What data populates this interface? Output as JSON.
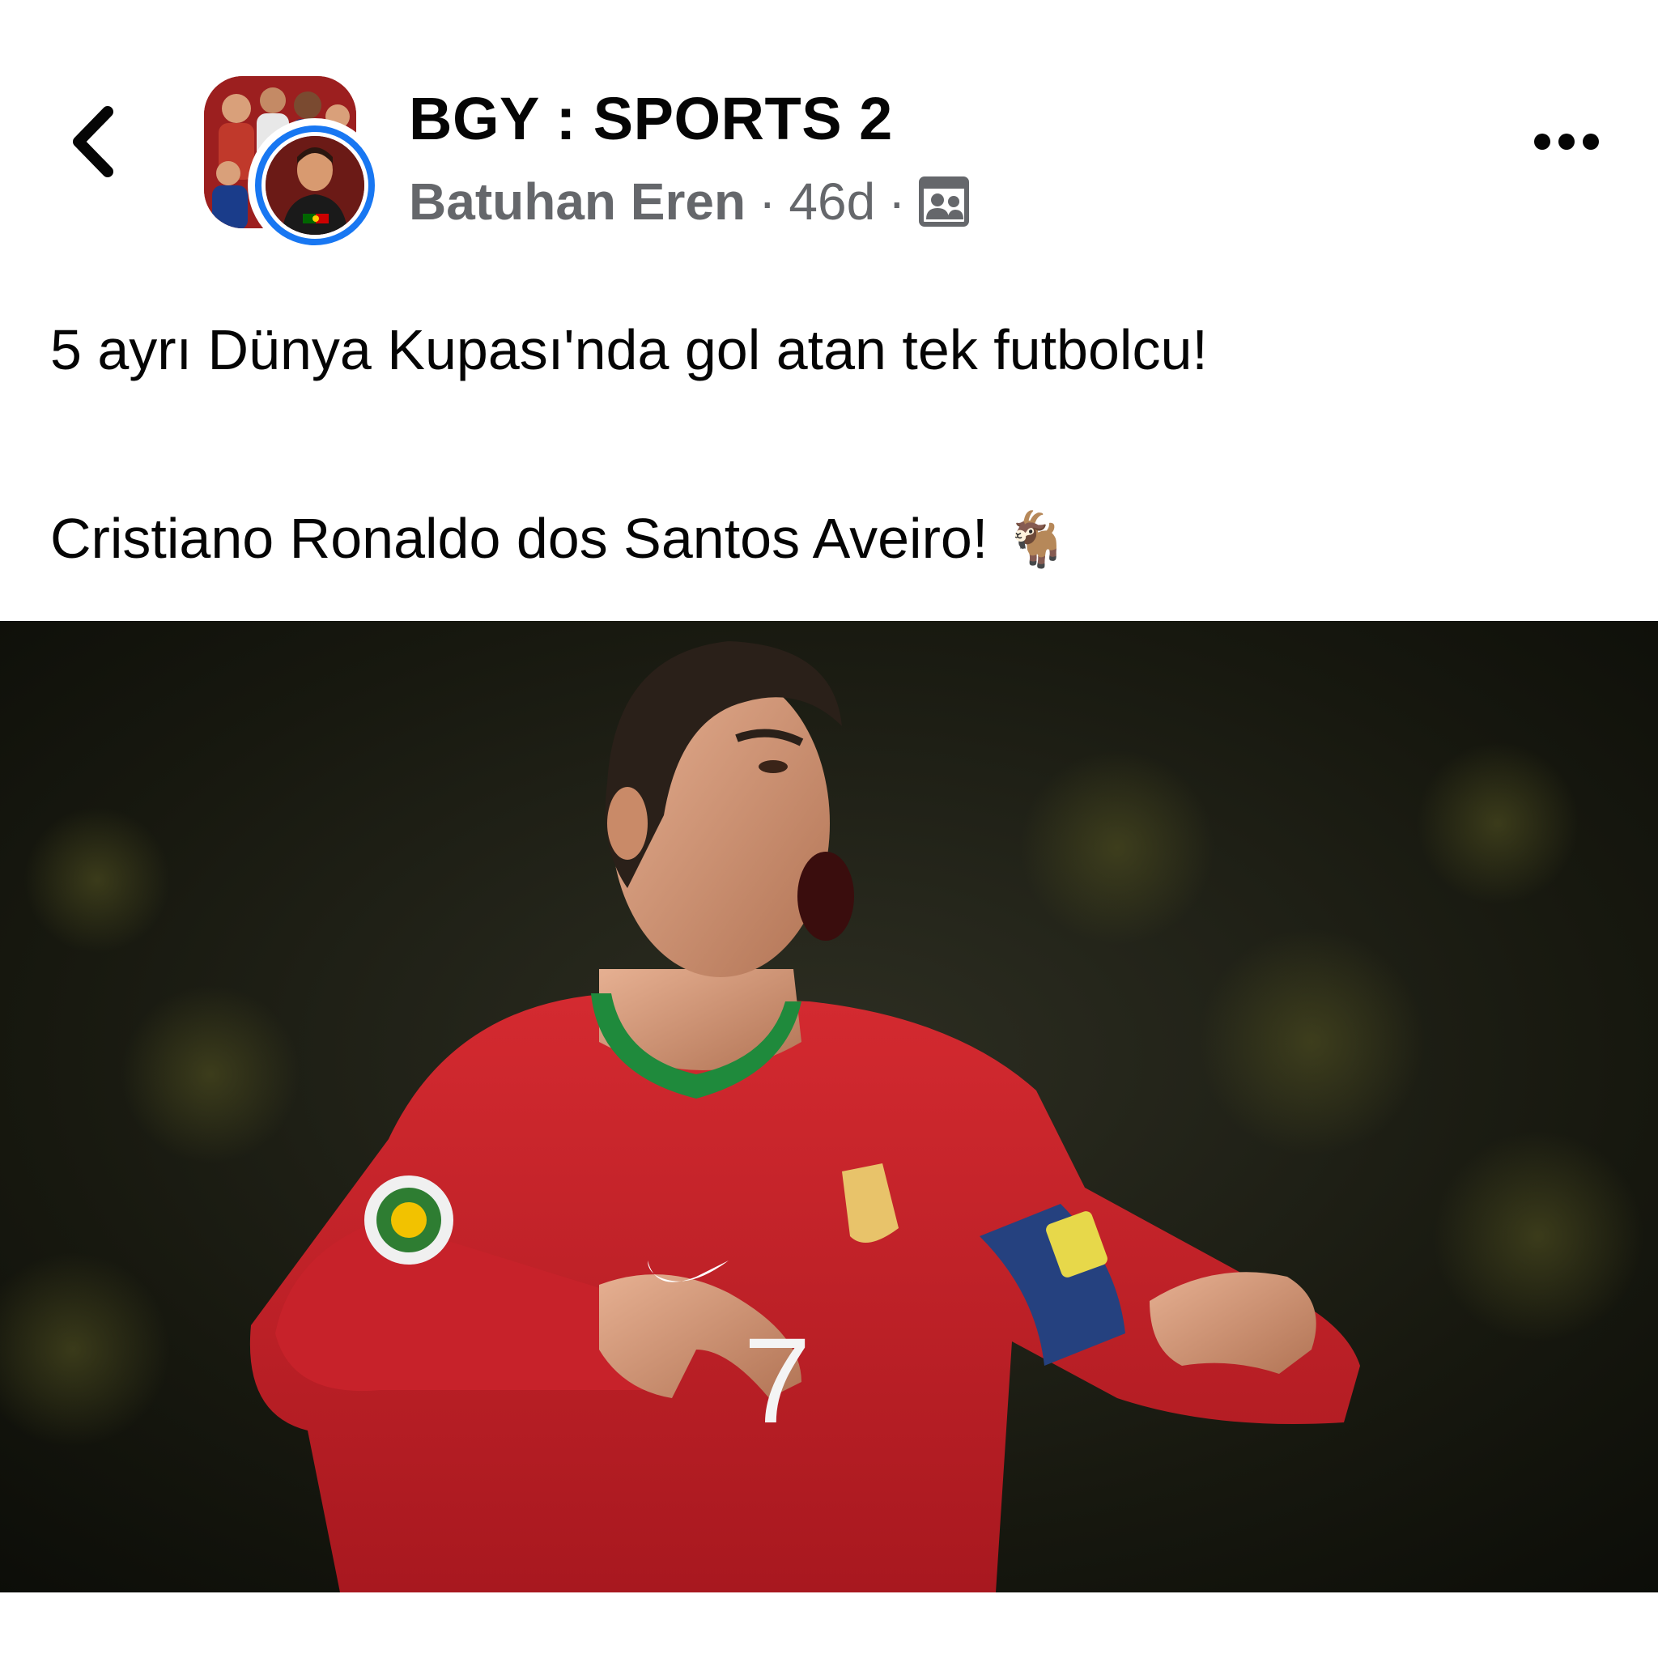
{
  "header": {
    "group_name": "BGY : SPORTS 2",
    "author": "Batuhan Eren",
    "separator": "·",
    "age": "46d",
    "audience_icon": "group-members-icon",
    "back_icon": "chevron-left-icon",
    "more_icon": "more-horizontal-icon"
  },
  "post": {
    "line1": "5 ayrı Dünya Kupası'nda gol atan tek futbolcu!",
    "line2": "Cristiano Ronaldo dos Santos Aveiro!",
    "emoji": "🐐"
  },
  "photo": {
    "jersey_number": "7"
  },
  "colors": {
    "accent": "#1877f2",
    "secondary_text": "#65676b",
    "jersey_red": "#c8202a",
    "collar_green": "#1f8a3c"
  }
}
